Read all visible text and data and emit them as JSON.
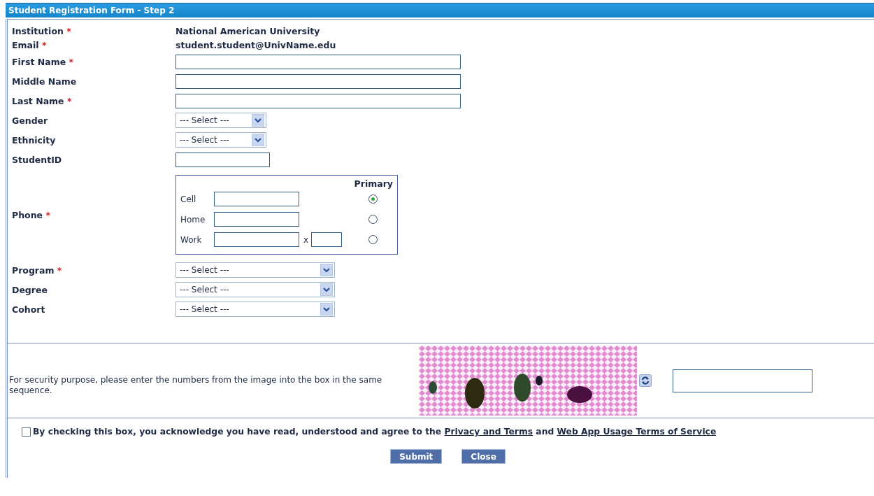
{
  "window": {
    "title": "Student Registration Form - Step 2"
  },
  "fields": [
    {
      "label": "Institution",
      "marker": "*",
      "kind": "value",
      "value": "National American University"
    },
    {
      "label": "Email",
      "marker": "*",
      "kind": "value",
      "value": "student.student@UnivName.edu"
    },
    {
      "label": "First Name",
      "marker": "*",
      "kind": "input"
    },
    {
      "label": "Middle Name",
      "kind": "input"
    },
    {
      "label": "Last Name",
      "marker": "*",
      "kind": "input"
    },
    {
      "label": "Gender",
      "kind": "select",
      "value": "--- Select ---"
    },
    {
      "label": "Ethnicity",
      "kind": "select",
      "value": "--- Select ---"
    },
    {
      "label": "StudentID",
      "kind": "shortinput"
    },
    {
      "label": "Phone",
      "marker": "*",
      "kind": "phone",
      "primary_heading": "Primary",
      "lines": [
        {
          "label": "Cell",
          "selected": true
        },
        {
          "label": "Home",
          "selected": false
        },
        {
          "label": "Work",
          "extension_label": "x",
          "selected": false
        }
      ]
    },
    {
      "label": "Program",
      "marker": "*",
      "kind": "wideselect",
      "value": "--- Select ---"
    },
    {
      "label": "Degree",
      "kind": "wideselect",
      "value": "--- Select ---"
    },
    {
      "label": "Cohort",
      "kind": "wideselect",
      "value": "--- Select ---"
    }
  ],
  "captcha": {
    "prompt": "For security purpose, please enter the numbers from the image into the box in the same sequence."
  },
  "agreement": {
    "checked": false,
    "text": "By checking this box, you acknowledge you have read, understood and agree to the",
    "links": [
      "Privacy and Terms",
      "Web App Usage Terms of Service"
    ],
    "joiner": "and"
  },
  "buttons": [
    "Submit",
    "Close"
  ]
}
